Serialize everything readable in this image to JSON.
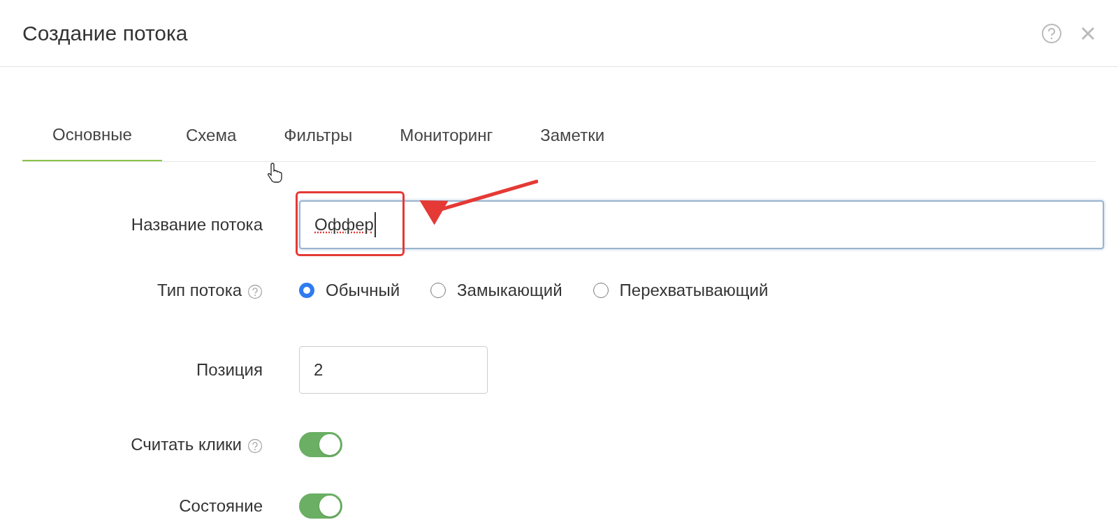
{
  "dialog": {
    "title": "Создание потока"
  },
  "tabs": [
    {
      "label": "Основные",
      "selected": true
    },
    {
      "label": "Схема",
      "selected": false
    },
    {
      "label": "Фильтры",
      "selected": false
    },
    {
      "label": "Мониторинг",
      "selected": false
    },
    {
      "label": "Заметки",
      "selected": false
    }
  ],
  "fields": [
    {
      "kind": "text",
      "label": "Название потока",
      "help_icon": false,
      "value": "Оффер",
      "focused": true
    },
    {
      "kind": "radio",
      "label": "Тип потока",
      "help_icon": true,
      "options": [
        {
          "label": "Обычный",
          "selected": true
        },
        {
          "label": "Замыкающий",
          "selected": false
        },
        {
          "label": "Перехватывающий",
          "selected": false
        }
      ]
    },
    {
      "kind": "number",
      "label": "Позиция",
      "help_icon": false,
      "value": "2",
      "focused": false
    },
    {
      "kind": "toggle",
      "label": "Считать клики",
      "help_icon": true,
      "on": true
    },
    {
      "kind": "toggle",
      "label": "Состояние",
      "help_icon": false,
      "on": true
    }
  ]
}
